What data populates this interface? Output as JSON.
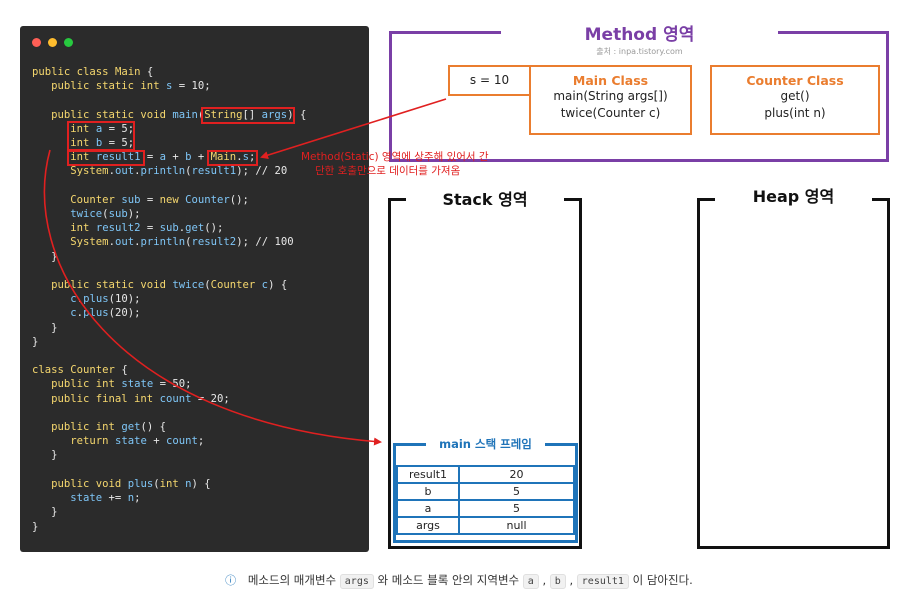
{
  "code_window": {
    "dot_colors": [
      "#ff5f56",
      "#ffbd2e",
      "#27c93f"
    ]
  },
  "method_area": {
    "title": "Method 영역",
    "source": "출처 : inpa.tistory.com",
    "static_var": "s = 10",
    "main_class": {
      "title": "Main Class",
      "methods": [
        "main(String args[])",
        "twice(Counter c)"
      ]
    },
    "counter_class": {
      "title": "Counter Class",
      "methods": [
        "get()",
        "plus(int n)"
      ]
    }
  },
  "annotation": {
    "line1": "Method(Static) 영역에 상주해 있어서 간",
    "line2": "단한 호출만으로 데이터를 가져옴"
  },
  "stack_area": {
    "title": "Stack 영역"
  },
  "heap_area": {
    "title": "Heap 영역"
  },
  "stack_frame": {
    "title": "main 스택 프레임",
    "rows": [
      {
        "name": "result1",
        "value": "20"
      },
      {
        "name": "b",
        "value": "5"
      },
      {
        "name": "a",
        "value": "5"
      },
      {
        "name": "args",
        "value": "null"
      }
    ]
  },
  "caption": {
    "icon": "info-icon",
    "text1": "메소드의 매개변수",
    "code1": "args",
    "text2": "와 메소드 블록 안의 지역변수",
    "code2": "a",
    "sep1": ",",
    "code3": "b",
    "sep2": ",",
    "code4": "result1",
    "text3": "이 담아진다."
  },
  "colors": {
    "method_border": "#7a3fa6",
    "class_border": "#ea7d2f",
    "frame_border": "#1f74b9",
    "highlight": "#e02020"
  }
}
